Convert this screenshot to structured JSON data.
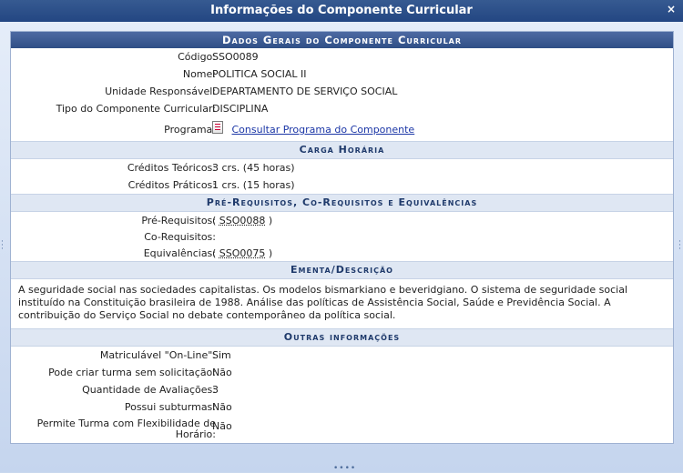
{
  "window": {
    "title": "Informações do Componente Curricular",
    "close_label": "×"
  },
  "dados_gerais": {
    "caption": "Dados Gerais do Componente Curricular",
    "codigo_label": "Código:",
    "codigo": "SSO0089",
    "nome_label": "Nome:",
    "nome": "POLITICA SOCIAL II",
    "unidade_label": "Unidade Responsável:",
    "unidade": "DEPARTAMENTO DE SERVIÇO SOCIAL",
    "tipo_label": "Tipo do Componente Curricular:",
    "tipo": "DISCIPLINA",
    "programa_label": "Programa:",
    "programa_link": "Consultar Programa do Componente"
  },
  "carga_horaria": {
    "caption": "Carga Horária",
    "teoricos_label": "Créditos Teóricos:",
    "teoricos": "3 crs. (45 horas)",
    "praticos_label": "Créditos Práticos:",
    "praticos": "1 crs. (15 horas)"
  },
  "requisitos": {
    "caption": "Pré-Requisitos, Co-Requisitos e Equivalências",
    "pre_label": "Pré-Requisitos:",
    "pre_open": "(",
    "pre_code": "SSO0088",
    "pre_close": ")",
    "co_label": "Co-Requisitos:",
    "equiv_label": "Equivalências:",
    "equiv_open": "(",
    "equiv_code": "SSO0075",
    "equiv_close": ")"
  },
  "ementa": {
    "caption": "Ementa/Descrição",
    "text": "A seguridade social nas sociedades capitalistas. Os modelos bismarkiano e beveridgiano. O sistema de seguridade social instituído na Constituição brasileira de 1988. Análise das políticas de Assistência Social, Saúde e Previdência Social. A contribuição do Serviço Social no debate contemporâneo da política social."
  },
  "outras": {
    "caption": "Outras informações",
    "matriculavel_label": "Matriculável \"On-Line\":",
    "matriculavel": "Sim",
    "criar_turma_label": "Pode criar turma sem solicitação:",
    "criar_turma": "Não",
    "avaliacoes_label": "Quantidade de Avaliações:",
    "avaliacoes": "3",
    "subturmas_label": "Possui subturmas:",
    "subturmas": "Não",
    "flex_label_1": "Permite Turma com Flexibilidade de",
    "flex_label_2": "Horário:",
    "flex": "Não"
  },
  "colors": {
    "titlebar": "#234682",
    "caption": "#2f4f86",
    "link": "#1b36a6"
  }
}
